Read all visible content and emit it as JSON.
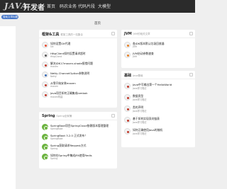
{
  "app": {
    "logo": "JAVA",
    "logo_sub": "开发者",
    "nav": [
      "首页",
      "码农业务",
      "代码片段",
      "大模型"
    ]
  },
  "search_pill": "搜索文章标题关键字",
  "section_title": "首页",
  "left_items": [
    "",
    "",
    "",
    "",
    "",
    ""
  ],
  "cards": {
    "tools": {
      "title": "框架&工具",
      "sub": "框架工具的一站集合",
      "items": [
        {
          "title": "如何设置Git代理",
          "sub": "Git",
          "color": "#e84d31"
        },
        {
          "title": "HttpClient如何设置请求超时",
          "sub": "HttpClient",
          "color": "#555"
        },
        {
          "title": "解决JDK17maven-shade报错问题",
          "sub": "maven",
          "color": "#c0392b"
        },
        {
          "title": "Netty-ChannelOption参数说明",
          "sub": "Netty",
          "color": "#3a6db5"
        },
        {
          "title": "从零开始安装maven",
          "sub": "maven",
          "color": "#c0392b"
        },
        {
          "title": "Java项目如何正确集成lombok",
          "sub": "maven构建",
          "color": "#c0392b"
        }
      ]
    },
    "jvm": {
      "title": "JVM",
      "sub": "JVM的相关文章",
      "items": [
        {
          "title": "各JDK版本默认垃圾回收器",
          "sub": "JVM",
          "color": "#e67e22"
        },
        {
          "title": "JVM启动参数速查",
          "sub": "JVM",
          "color": "#e67e22"
        }
      ]
    },
    "basics": {
      "title": "基础",
      "sub": "Java基础",
      "items": [
        {
          "title": "Java中写输出第一个HelloWorld",
          "sub": "Java学习笔记",
          "color": "#c0392b"
        },
        {
          "title": "数据类型",
          "sub": "Java学习笔记",
          "color": "#c0392b"
        },
        {
          "title": "类的声明",
          "sub": "Java学习笔记",
          "color": "#c0392b"
        },
        {
          "title": "基于如何实现双向链表",
          "sub": "Java学习笔记",
          "color": "#c0392b"
        },
        {
          "title": "如何正确使用Java的随机",
          "sub": "Java学习笔记",
          "color": "#c0392b"
        }
      ]
    },
    "spring": {
      "title": "Spring",
      "sub": "Spring全家桶",
      "items": [
        {
          "title": "SpringBoot项目SpringCloud依赖版本管理整理",
          "sub": "SpringBoot"
        },
        {
          "title": "SpringBoot 3.2.0 正式发布！",
          "sub": "SpringBoot"
        },
        {
          "title": "Spring获取请求Request方式",
          "sub": "Spring"
        },
        {
          "title": "如何在Spring中集成JPA使用Redis",
          "sub": "Spring"
        }
      ]
    }
  }
}
